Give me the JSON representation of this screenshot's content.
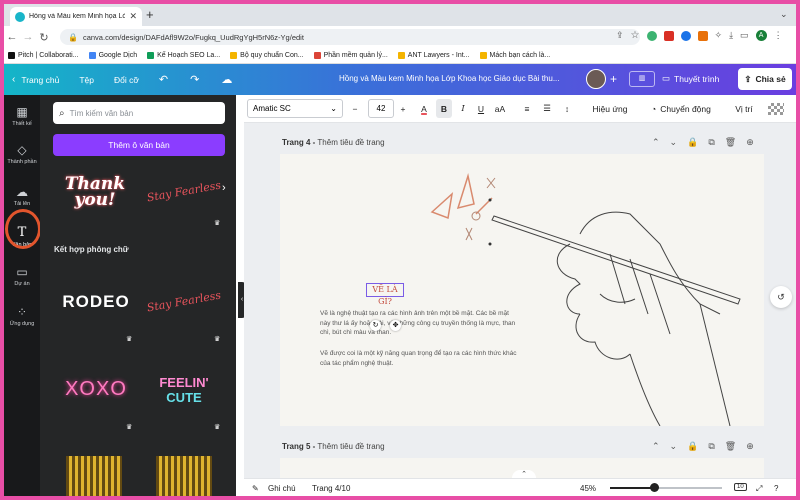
{
  "browser": {
    "tab_title": "Hồng và Màu kem Minh họa Lớ",
    "url": "canva.com/design/DAFdAfl9W2o/Fugkq_UudRgYgH5rN6z-Yg/edit",
    "bookmarks": [
      "Pitch | Collaborati...",
      "Google Dịch",
      "Kế Hoạch SEO La...",
      "Bộ quy chuẩn Con...",
      "Phần mềm quản lý...",
      "ANT Lawyers - Int...",
      "Mách bạn cách là..."
    ],
    "profile_initial": "A"
  },
  "canva_top": {
    "home": "Trang chủ",
    "file": "Tệp",
    "resize": "Đổi cỡ",
    "doc_title": "Hồng và Màu kem Minh họa Lớp Khoa học Giáo dục Bài thu...",
    "present": "Thuyết trình",
    "share": "Chia sẻ"
  },
  "rail": [
    {
      "label": "Thiết kế",
      "icon": "layout-icon"
    },
    {
      "label": "Thành phần",
      "icon": "elements-icon"
    },
    {
      "label": "Tải lên",
      "icon": "upload-icon"
    },
    {
      "label": "Văn bản",
      "icon": "text-icon"
    },
    {
      "label": "Dự án",
      "icon": "folder-icon"
    },
    {
      "label": "Ứng dụng",
      "icon": "apps-icon"
    }
  ],
  "panel": {
    "search_placeholder": "Tìm kiếm văn bản",
    "add_text": "Thêm ô văn bản",
    "section_title": "Kết hợp phông chữ",
    "tiles": {
      "thank": "Thank you!",
      "stay1": "Stay Fearless",
      "rodeo": "RODEO",
      "stay2": "Stay Fearless",
      "xoxo": "XOXO",
      "feelin": "FEELIN'",
      "cute": "CUTE"
    }
  },
  "toolbar": {
    "font": "Amatic SC",
    "size": "42",
    "effects": "Hiệu ứng",
    "animate": "Chuyển động",
    "position": "Vị trí"
  },
  "canvas": {
    "page4_num": "Trang 4 -",
    "page4_title": "Thêm tiêu đề trang",
    "page5_num": "Trang 5 -",
    "page5_title": "Thêm tiêu đề trang",
    "heading": "VẼ LÀ GÌ?",
    "para1": "Vẽ là nghệ thuật tạo ra các hình ảnh trên một bề mặt. Các bề mặt này thư  lá    ấy hoặc vải, và những công cụ truyền thống là mực, than chì, bút chì màu và than.",
    "para2": "Vẽ được coi là một kỹ năng quan trọng để tạo ra các hình thức khác của tác phẩm nghệ thuật."
  },
  "bottom": {
    "notes": "Ghi chú",
    "page": "Trang 4/10",
    "zoom": "45%",
    "grid_count": "10",
    "zoom_fraction": 0.39
  }
}
